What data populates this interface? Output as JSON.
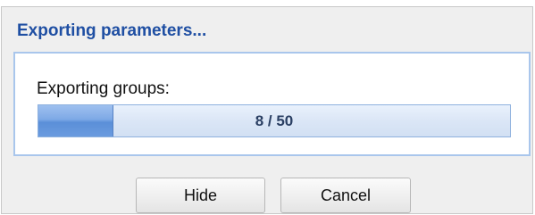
{
  "dialog": {
    "title": "Exporting parameters...",
    "progress": {
      "label": "Exporting groups:",
      "current": 8,
      "total": 50,
      "text": "8 / 50",
      "fraction": 0.16
    },
    "buttons": {
      "hide_label": "Hide",
      "cancel_label": "Cancel"
    }
  },
  "colors": {
    "title": "#1f4fa3",
    "panel_border": "#a9c6ec",
    "progress_fill": "#6a9bdf",
    "progress_track": "#dbe6f6"
  }
}
